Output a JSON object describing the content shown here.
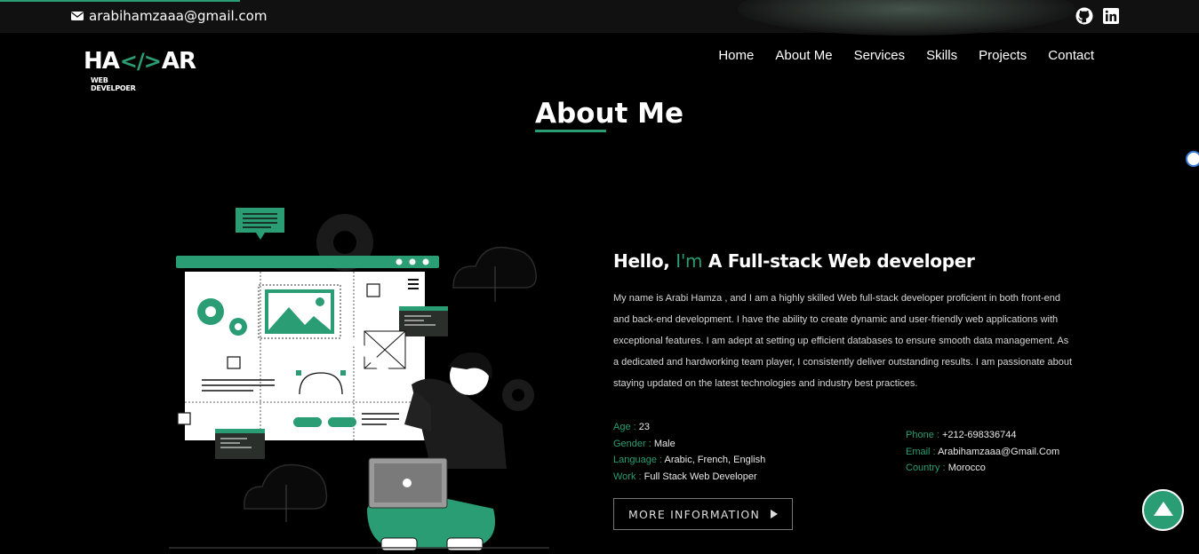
{
  "scroll_progress_percent": 20,
  "topbar": {
    "email": "arabihamzaaa@gmail.com",
    "email_icon": "envelope-icon",
    "social_icons": [
      "github-icon",
      "linkedin-icon"
    ]
  },
  "logo": {
    "left": "HA",
    "code": "</>",
    "right": "AR",
    "subtitle": "WEB DEVELPOER"
  },
  "nav": {
    "items": [
      "Home",
      "About Me",
      "Services",
      "Skills",
      "Projects",
      "Contact"
    ]
  },
  "section": {
    "title": "About Me"
  },
  "intro": {
    "greeting": "Hello,",
    "im": "I'm",
    "role": "A Full-stack Web developer",
    "description": "My name is Arabi Hamza , and I am a highly skilled Web full-stack developer proficient in both front-end and back-end development. I have the ability to create dynamic and user-friendly web applications with exceptional features. I am adept at setting up efficient databases to ensure smooth data management. As a dedicated and hardworking team player, I consistently deliver outstanding results. I am passionate about staying updated on the latest technologies and industry best practices."
  },
  "info_left": [
    {
      "label": "Age :",
      "value": "23"
    },
    {
      "label": "Gender :",
      "value": "Male"
    },
    {
      "label": "Language :",
      "value": "Arabic, French, English"
    },
    {
      "label": "Work :",
      "value": "Full Stack Web Developer"
    }
  ],
  "info_right": [
    {
      "label": "Phone :",
      "value": "+212-698336744"
    },
    {
      "label": "Email :",
      "value": "Arabihamzaaa@Gmail.Com"
    },
    {
      "label": "Country :",
      "value": "Morocco"
    }
  ],
  "buttons": {
    "more_info": "MORE INFORMATION"
  },
  "colors": {
    "accent": "#2a9d75",
    "background": "#000000",
    "topbar": "#111111"
  }
}
